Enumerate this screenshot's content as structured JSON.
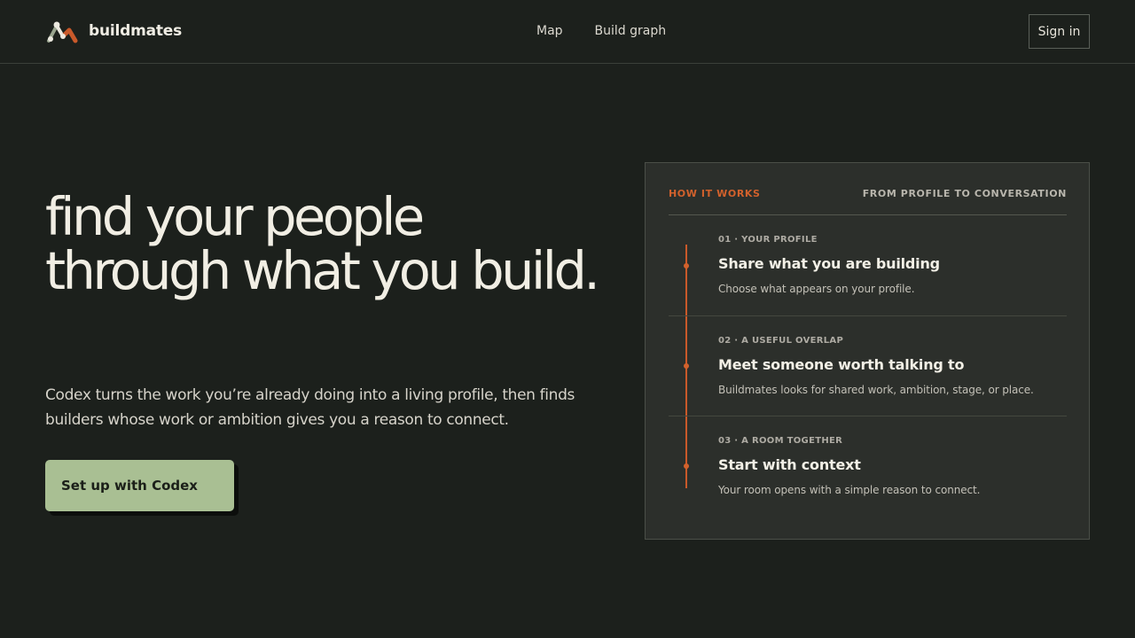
{
  "header": {
    "brand_name": "buildmates",
    "logo_icon": "buildmates-logo-icon",
    "nav": [
      {
        "label": "Map"
      },
      {
        "label": "Build graph"
      }
    ],
    "sign_in_label": "Sign in"
  },
  "hero": {
    "title": "find your people through what you build.",
    "subtitle": "Codex turns the work you’re already doing into a living profile, then finds builders whose work or ambition gives you a reason to connect.",
    "cta_label": "Set up with Codex"
  },
  "how_it_works": {
    "label": "HOW IT WORKS",
    "tagline": "FROM PROFILE TO CONVERSATION",
    "steps": [
      {
        "eyebrow": "01 · YOUR PROFILE",
        "title": "Share what you are building",
        "description": "Choose what appears on your profile."
      },
      {
        "eyebrow": "02 · A USEFUL OVERLAP",
        "title": "Meet someone worth talking to",
        "description": "Buildmates looks for shared work, ambition, stage, or place."
      },
      {
        "eyebrow": "03 · A ROOM TOGETHER",
        "title": "Start with context",
        "description": "Your room opens with a simple reason to connect."
      }
    ]
  },
  "colors": {
    "background": "#1c201c",
    "accent": "#d2612c",
    "cta_background": "#a9bf93",
    "panel_background": "#2c2f2b"
  }
}
